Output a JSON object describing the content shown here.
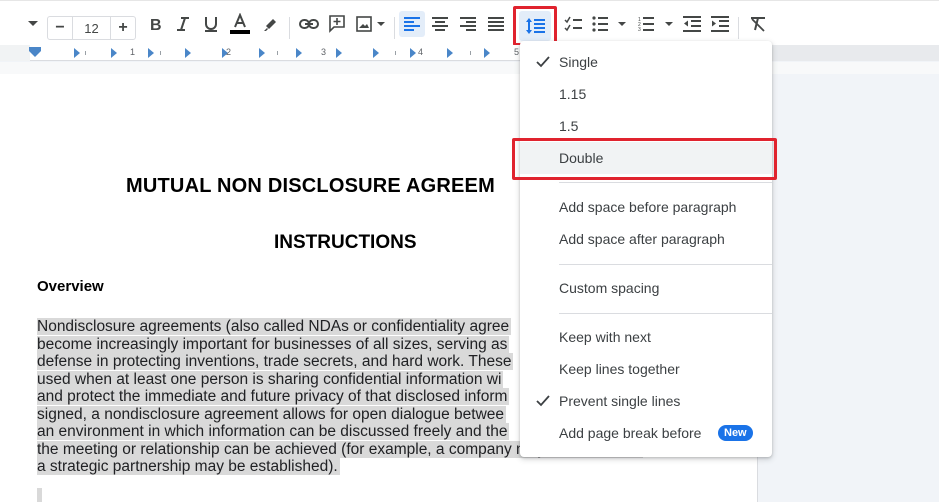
{
  "toolbar": {
    "font_size": "12",
    "decrease_font_label": "−",
    "increase_font_label": "+",
    "buttons": [
      {
        "name": "bold",
        "icon": "bold-icon"
      },
      {
        "name": "italic",
        "icon": "italic-icon"
      },
      {
        "name": "underline",
        "icon": "underline-icon"
      },
      {
        "name": "text-color",
        "icon": "text-color-icon",
        "color": "#000000"
      },
      {
        "name": "highlight-color",
        "icon": "highlighter-icon"
      },
      {
        "name": "insert-link",
        "icon": "link-icon"
      },
      {
        "name": "add-comment",
        "icon": "comment-add-icon"
      },
      {
        "name": "insert-image",
        "icon": "image-icon"
      },
      {
        "name": "align-left",
        "icon": "align-left-icon",
        "active": true
      },
      {
        "name": "align-center",
        "icon": "align-center-icon"
      },
      {
        "name": "align-right",
        "icon": "align-right-icon"
      },
      {
        "name": "justify",
        "icon": "align-justify-icon"
      },
      {
        "name": "line-spacing",
        "icon": "line-spacing-icon",
        "active": true
      },
      {
        "name": "checklist",
        "icon": "checklist-icon"
      },
      {
        "name": "bulleted-list",
        "icon": "bulleted-list-icon"
      },
      {
        "name": "numbered-list",
        "icon": "numbered-list-icon"
      },
      {
        "name": "decrease-indent",
        "icon": "indent-decrease-icon"
      },
      {
        "name": "increase-indent",
        "icon": "indent-increase-icon"
      },
      {
        "name": "clear-formatting",
        "icon": "clear-formatting-icon"
      }
    ]
  },
  "ruler": {
    "numbers": [
      "1",
      "2",
      "3",
      "4",
      "5"
    ]
  },
  "document": {
    "title": "MUTUAL NON DISCLOSURE AGREEM",
    "subtitle": "INSTRUCTIONS",
    "section_heading": "Overview",
    "paragraph_lines": [
      "Nondisclosure agreements (also called NDAs or confidentiality agree",
      "become increasingly important for businesses of all sizes, serving as",
      "defense in protecting inventions, trade secrets, and hard work. These",
      "used when at least one person is sharing confidential information wi",
      "and protect the immediate and future privacy of that disclosed inform",
      "signed, a nondisclosure agreement allows for open dialogue betwee",
      "an environment in which information can be discussed freely and the",
      "the meeting or relationship can be achieved (for example, a company may be created or",
      "a strategic partnership may be established)."
    ]
  },
  "line_spacing_menu": {
    "items": [
      {
        "label": "Single",
        "checked": true
      },
      {
        "label": "1.15",
        "checked": false
      },
      {
        "label": "1.5",
        "checked": false
      },
      {
        "label": "Double",
        "checked": false,
        "highlighted": true
      },
      {
        "label": "Add space before paragraph",
        "checked": false
      },
      {
        "label": "Add space after paragraph",
        "checked": false
      },
      {
        "label": "Custom spacing",
        "checked": false
      },
      {
        "label": "Keep with next",
        "checked": false
      },
      {
        "label": "Keep lines together",
        "checked": false
      },
      {
        "label": "Prevent single lines",
        "checked": true
      },
      {
        "label": "Add page break before",
        "checked": false,
        "badge": "New"
      }
    ]
  },
  "colors": {
    "accent": "#1a73e8",
    "annotation_red": "#e0232e",
    "selection_grey": "#d9d9d9"
  }
}
